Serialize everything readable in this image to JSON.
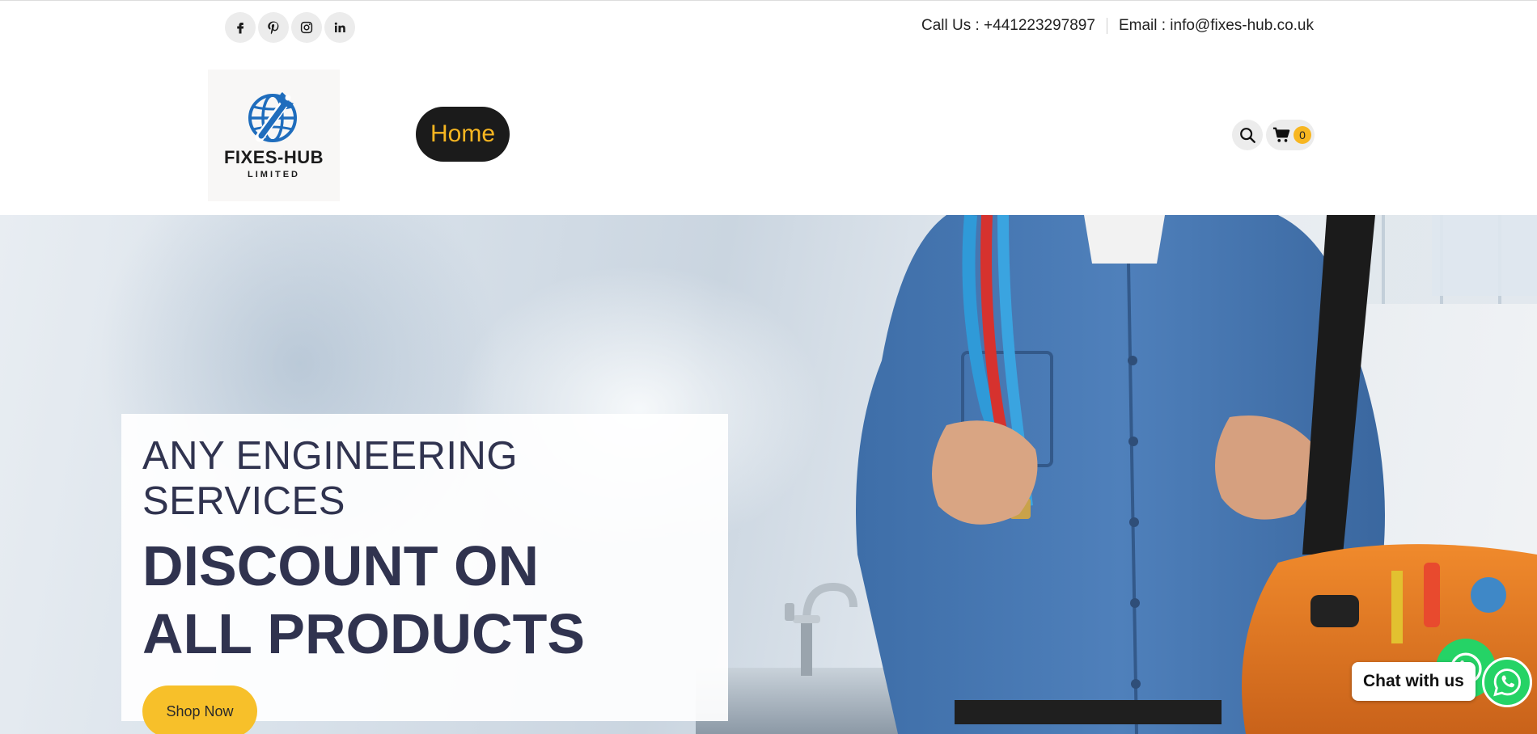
{
  "topbar": {
    "social": [
      {
        "name": "facebook-icon"
      },
      {
        "name": "pinterest-icon"
      },
      {
        "name": "instagram-icon"
      },
      {
        "name": "linkedin-icon"
      }
    ],
    "phone_text": "Call Us : +441223297897",
    "email_text": "Email : info@fixes-hub.co.uk"
  },
  "header": {
    "logo": {
      "brand": "FIXES-HUB",
      "sub": "LIMITED"
    },
    "nav": {
      "home_label": "Home"
    },
    "cart_count": "0"
  },
  "hero": {
    "subtitle": "ANY ENGINEERING SERVICES",
    "title": "DISCOUNT ON ALL PRODUCTS",
    "button_label": "Shop Now"
  },
  "chat": {
    "label": "Chat with us"
  },
  "colors": {
    "accent_yellow": "#f7b621",
    "button_yellow": "#f7c02a",
    "nav_dark": "#1b1b1b",
    "hero_text": "#30334f",
    "whatsapp_green": "#25d366",
    "logo_blue": "#1f6dbd"
  }
}
